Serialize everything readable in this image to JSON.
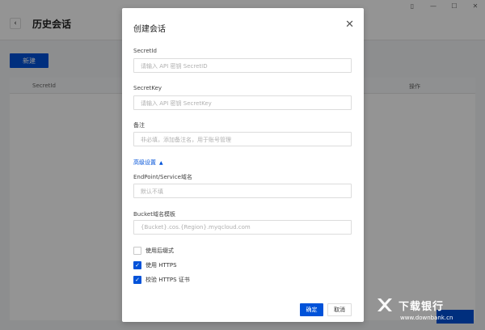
{
  "background": {
    "page_title": "历史会话",
    "new_button": "新建",
    "table": {
      "columns": [
        "SecretId",
        "操作"
      ]
    }
  },
  "dialog": {
    "title": "创建会话",
    "fields": {
      "secret_id": {
        "label": "SecretId",
        "placeholder": "请输入 API 密钥 SecretID"
      },
      "secret_key": {
        "label": "SecretKey",
        "placeholder": "请输入 API 密钥 SecretKey"
      },
      "remark": {
        "label": "备注",
        "placeholder": "非必填，添加备注名，用于账号管理"
      },
      "endpoint": {
        "label": "EndPoint/Service域名",
        "placeholder": "默认不填"
      },
      "bucket_domain": {
        "label": "Bucket域名模板",
        "placeholder": "{Bucket}.cos.{Region}.myqcloud.com"
      }
    },
    "advanced_label": "高级设置",
    "options": [
      {
        "label": "使用后缀式",
        "checked": false
      },
      {
        "label": "使用 HTTPS",
        "checked": true
      },
      {
        "label": "校验 HTTPS 证书",
        "checked": true
      }
    ],
    "ok_button": "确定",
    "cancel_button": "取消"
  },
  "watermark": {
    "text": "下载银行",
    "sub": "www.downbank.cn"
  },
  "colors": {
    "accent": "#0052d9",
    "overlay": "rgba(0,0,0,0.42)"
  }
}
